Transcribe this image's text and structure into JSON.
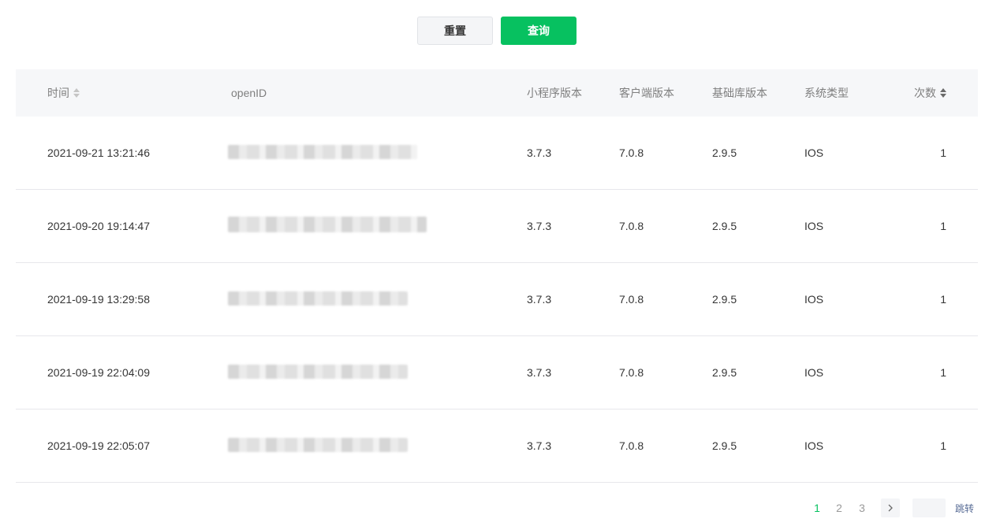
{
  "toolbar": {
    "reset_label": "重置",
    "query_label": "查询",
    "query_color": "#07c160"
  },
  "table": {
    "headers": {
      "time": "时间",
      "openid": "openID",
      "mini_version": "小程序版本",
      "client_version": "客户端版本",
      "base_version": "基础库版本",
      "system_type": "系统类型",
      "count": "次数"
    },
    "sort_icons": {
      "time": "sort-icon",
      "count": "sort-icon"
    },
    "rows": [
      {
        "time": "2021-09-21 13:21:46",
        "openid": "",
        "mini_version": "3.7.3",
        "client_version": "7.0.8",
        "base_version": "2.9.5",
        "system_type": "IOS",
        "count": "1"
      },
      {
        "time": "2021-09-20 19:14:47",
        "openid": "",
        "mini_version": "3.7.3",
        "client_version": "7.0.8",
        "base_version": "2.9.5",
        "system_type": "IOS",
        "count": "1"
      },
      {
        "time": "2021-09-19 13:29:58",
        "openid": "",
        "mini_version": "3.7.3",
        "client_version": "7.0.8",
        "base_version": "2.9.5",
        "system_type": "IOS",
        "count": "1"
      },
      {
        "time": "2021-09-19 22:04:09",
        "openid": "",
        "mini_version": "3.7.3",
        "client_version": "7.0.8",
        "base_version": "2.9.5",
        "system_type": "IOS",
        "count": "1"
      },
      {
        "time": "2021-09-19 22:05:07",
        "openid": "",
        "mini_version": "3.7.3",
        "client_version": "7.0.8",
        "base_version": "2.9.5",
        "system_type": "IOS",
        "count": "1"
      }
    ]
  },
  "pagination": {
    "pages": [
      "1",
      "2",
      "3"
    ],
    "current_page": "1",
    "next_icon": "chevron-right-icon",
    "jump_value": "",
    "jump_label": "跳转"
  }
}
